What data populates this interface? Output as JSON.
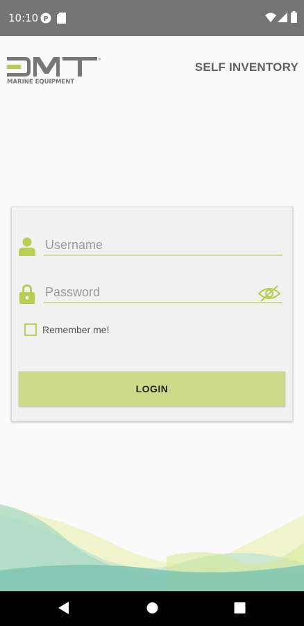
{
  "status_bar": {
    "time": "10:10"
  },
  "header": {
    "logo_text": "DMT",
    "logo_subtext": "MARINE EQUIPMENT",
    "title": "SELF INVENTORY"
  },
  "login_form": {
    "username_placeholder": "Username",
    "password_placeholder": "Password",
    "remember_label": "Remember me!",
    "login_button": "LOGIN"
  },
  "colors": {
    "accent": "#b7cf53",
    "button": "#ccd986",
    "status_bar": "#757575"
  },
  "icons": [
    "user-icon",
    "lock-icon",
    "eye-off-icon",
    "wifi-icon",
    "signal-icon",
    "battery-icon",
    "back-icon",
    "home-icon",
    "recents-icon"
  ]
}
